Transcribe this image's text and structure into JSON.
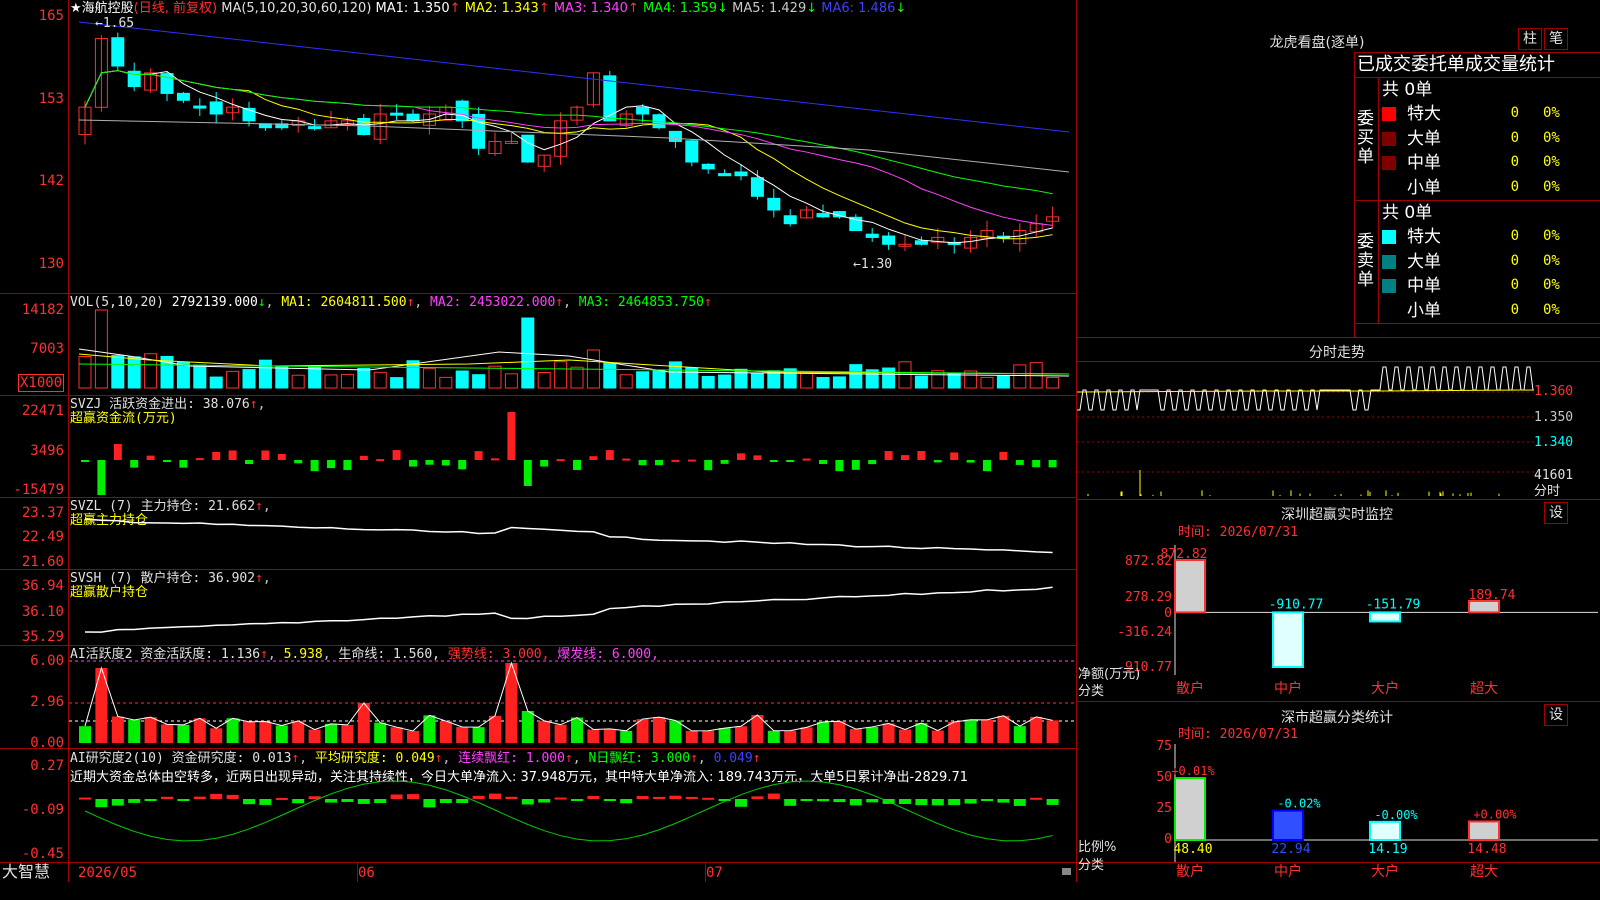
{
  "stock": {
    "star": "★",
    "name": "海航控股",
    "mode": "(日线, 前复权)",
    "ma_label": "MA(5,10,20,30,60,120)",
    "ma": [
      {
        "label": "MA1:",
        "value": "1.350",
        "arrow": "↑",
        "color": "#ffffff"
      },
      {
        "label": "MA2:",
        "value": "1.343",
        "arrow": "↑",
        "color": "#ffff00"
      },
      {
        "label": "MA3:",
        "value": "1.340",
        "arrow": "↑",
        "color": "#ff40ff"
      },
      {
        "label": "MA4:",
        "value": "1.359",
        "arrow": "↓",
        "color": "#00ff00"
      },
      {
        "label": "MA5:",
        "value": "1.429",
        "arrow": "↓",
        "color": "#c8c8c8"
      },
      {
        "label": "MA6:",
        "value": "1.486",
        "arrow": "↓",
        "color": "#4040ff"
      }
    ],
    "high_mark": "←1.65",
    "low_mark": "←1.30"
  },
  "price_axis": [
    "165",
    "153",
    "142",
    "130"
  ],
  "vol": {
    "header": "VOL(5,10,20)",
    "value": "2792139.000",
    "arrow": "↓",
    "ma1": "MA1: 2604811.500",
    "ma2": "MA2: 2453022.000",
    "ma3": "MA3: 2464853.750",
    "up": "↑",
    "axis": [
      "14182",
      "7003"
    ],
    "unit": "X1000"
  },
  "svzj": {
    "title": "SVZJ  活跃资金进出: 38.076",
    "up": "↑",
    ",": ",",
    "sub": "超赢资金流(万元)",
    "axis": [
      "22471",
      "3496",
      "-15479"
    ]
  },
  "svzl": {
    "title": "SVZL (7) 主力持仓: 21.662",
    "up": "↑",
    "sub": "超赢主力持仓",
    "axis": [
      "23.37",
      "22.49",
      "21.60"
    ]
  },
  "svsh": {
    "title": "SVSH (7) 散户持仓: 36.902",
    "up": "↑",
    "sub": "超赢散户持仓",
    "axis": [
      "36.94",
      "36.10",
      "35.29"
    ]
  },
  "ai1": {
    "title": "AI活跃度2 资金活跃度: 1.136",
    "v2": "5.938",
    "life": "生命线: 1.560,",
    "strong": "强势线: 3.000,",
    "burst": "爆发线: 6.000,",
    "axis": [
      "6.00",
      "2.96",
      "0.00"
    ]
  },
  "ai2": {
    "title": "AI研究度2(10) 资金研究度: 0.013",
    "avg": "平均研究度: 0.049",
    "cont": "连续飘红: 1.000",
    "nday": "N日飘红: 3.000",
    "last": "0.049",
    "note": "近期大资金总体由空转多，近两日出现异动，关注其持续性，今日大单净流入: 37.948万元，其中特大单净流入: 189.743万元，大单5日累计净出-2829.71",
    "axis": [
      "0.27",
      "-0.09",
      "-0.45"
    ]
  },
  "bottom": {
    "logo": "大智慧",
    "dates": [
      "2026/05",
      "06",
      "07"
    ]
  },
  "right": {
    "title": "龙虎看盘(逐单)",
    "btn1": "柱",
    "btn2": "笔",
    "tabs": [
      "已成交",
      "委托单",
      "成交量统计"
    ],
    "buy_label": "委买单",
    "sell_label": "委卖单",
    "buy_total": "共 0单",
    "sell_total": "共 0单",
    "buy_rows": [
      {
        "name": "特大",
        "color": "#ff0000",
        "n": "0",
        "pct": "0%"
      },
      {
        "name": "大单",
        "color": "#800000",
        "n": "0",
        "pct": "0%"
      },
      {
        "name": "中单",
        "color": "#800000",
        "n": "0",
        "pct": "0%"
      },
      {
        "name": "小单",
        "color": "",
        "n": "0",
        "pct": "0%"
      }
    ],
    "sell_rows": [
      {
        "name": "特大",
        "color": "#00ffff",
        "n": "0",
        "pct": "0%"
      },
      {
        "name": "大单",
        "color": "#008080",
        "n": "0",
        "pct": "0%"
      },
      {
        "name": "中单",
        "color": "#008080",
        "n": "0",
        "pct": "0%"
      },
      {
        "name": "小单",
        "color": "",
        "n": "0",
        "pct": "0%"
      }
    ],
    "fenshi": {
      "title": "分时走势",
      "axis": [
        "1.360",
        "1.350",
        "1.340",
        "41601",
        "分时"
      ]
    },
    "sz": {
      "title": "深圳超赢实时监控",
      "btn": "设",
      "time": "时间: 2026/07/31",
      "axis": [
        "872.82",
        "278.29",
        "0",
        "-316.24",
        "-910.77"
      ],
      "ylabel1": "净额(万元)",
      "ylabel2": "分类"
    },
    "sz2": {
      "title": "深市超赢分类统计",
      "btn": "设",
      "time": "时间: 2026/07/31",
      "axis": [
        "75",
        "50",
        "25",
        "0"
      ],
      "ylabel1": "比例%",
      "ylabel2": "分类"
    }
  },
  "chart_data": [
    {
      "type": "bar",
      "title": "深圳超赢实时监控",
      "categories": [
        "散户",
        "中户",
        "大户",
        "超大"
      ],
      "values": [
        872.82,
        -910.77,
        -151.79,
        189.74
      ],
      "ylim": [
        -910.77,
        872.82
      ]
    },
    {
      "type": "bar",
      "title": "深市超赢分类统计",
      "categories": [
        "散户",
        "中户",
        "大户",
        "超大"
      ],
      "values": [
        48.4,
        22.94,
        14.19,
        14.48
      ],
      "change": [
        "+0.01%",
        "-0.02%",
        "-0.00%",
        "+0.00%"
      ],
      "ylim": [
        0,
        75
      ]
    }
  ]
}
